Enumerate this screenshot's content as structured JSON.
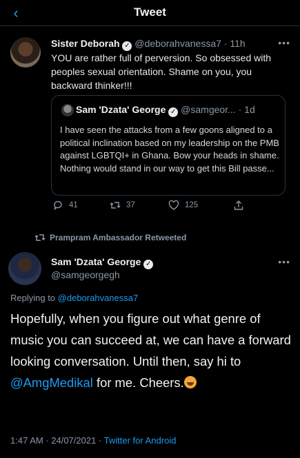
{
  "header": {
    "title": "Tweet",
    "back_icon": "chevron-left-icon"
  },
  "quoting_tweet": {
    "display_name": "Sister Deborah",
    "handle_time": "@deborahvanessa7 · 11h",
    "text": "YOU are rather full of perversion. So obsessed with peoples sexual orientation. Shame on you, you backward thinker!!!",
    "quoted": {
      "display_name": "Sam 'Dzata' George",
      "handle_time": "@samgeor... · 1d",
      "text": "I have seen the attacks from a few goons aligned to a political inclination based on my leadership on the PMB against LGBTQI+ in Ghana. Bow your heads in shame. Nothing would stand in our way to get this Bill passe..."
    },
    "actions": {
      "replies": "41",
      "retweets": "37",
      "likes": "125"
    }
  },
  "retweet_label": "Prampram Ambassador Retweeted",
  "main_tweet": {
    "display_name": "Sam 'Dzata' George",
    "handle": "@samgeorgegh",
    "replying_prefix": "Replying to",
    "replying_to": "@deborahvanessa7",
    "body_part1": "Hopefully, when you figure out what genre of music you can succeed at, we can have a forward looking conversation. Until then, say hi to",
    "mention": "@AmgMedikal",
    "body_part2": "for me. Cheers.",
    "timestamp": "1:47 AM · 24/07/2021 ·",
    "source": "Twitter for Android"
  },
  "colors": {
    "background": "#000000",
    "accent": "#1d9bf0",
    "muted": "#8b98a5"
  }
}
